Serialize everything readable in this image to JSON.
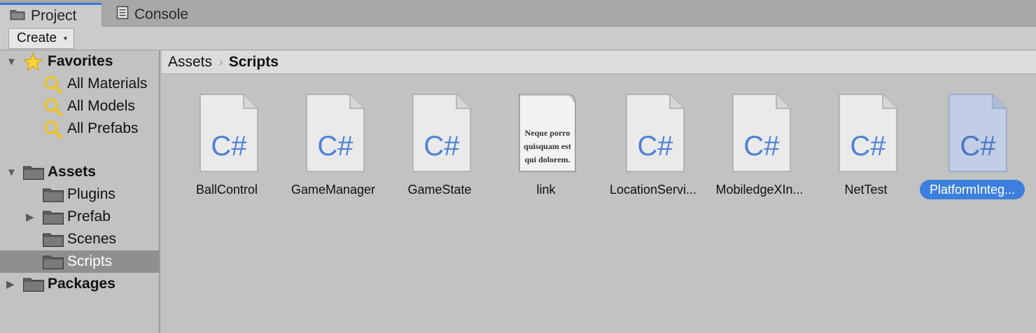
{
  "tabs": [
    {
      "label": "Project",
      "icon": "folder-icon"
    },
    {
      "label": "Console",
      "icon": "console-icon"
    }
  ],
  "toolbar": {
    "create_label": "Create",
    "create_caret": "▼"
  },
  "sidebar": {
    "favorites": {
      "label": "Favorites",
      "icon": "star-icon",
      "items": [
        {
          "label": "All Materials",
          "icon": "search-icon"
        },
        {
          "label": "All Models",
          "icon": "search-icon"
        },
        {
          "label": "All Prefabs",
          "icon": "search-icon"
        }
      ]
    },
    "assets": {
      "label": "Assets",
      "icon": "folder-icon",
      "items": [
        {
          "label": "Plugins"
        },
        {
          "label": "Prefab"
        },
        {
          "label": "Scenes"
        },
        {
          "label": "Scripts",
          "selected": true
        }
      ]
    },
    "packages": {
      "label": "Packages",
      "icon": "folder-icon"
    }
  },
  "breadcrumb": {
    "root": "Assets",
    "separator": "›",
    "current": "Scripts"
  },
  "assets": [
    {
      "name": "BallControl",
      "type": "csharp",
      "glyph": "C#"
    },
    {
      "name": "GameManager",
      "type": "csharp",
      "glyph": "C#"
    },
    {
      "name": "GameState",
      "type": "csharp",
      "glyph": "C#"
    },
    {
      "name": "link",
      "type": "text",
      "preview": [
        "Neque porro",
        "quisquam est",
        "qui dolorem."
      ]
    },
    {
      "name": "LocationServi...",
      "type": "csharp",
      "glyph": "C#"
    },
    {
      "name": "MobiledgeXIn...",
      "type": "csharp",
      "glyph": "C#"
    },
    {
      "name": "NetTest",
      "type": "csharp",
      "glyph": "C#"
    },
    {
      "name": "PlatformInteg...",
      "type": "csharp",
      "glyph": "C#",
      "selected": true
    }
  ],
  "colors": {
    "accent": "#3c7fde",
    "csharp_text": "#4f82d4",
    "selected_row": "#8f8f8f"
  }
}
